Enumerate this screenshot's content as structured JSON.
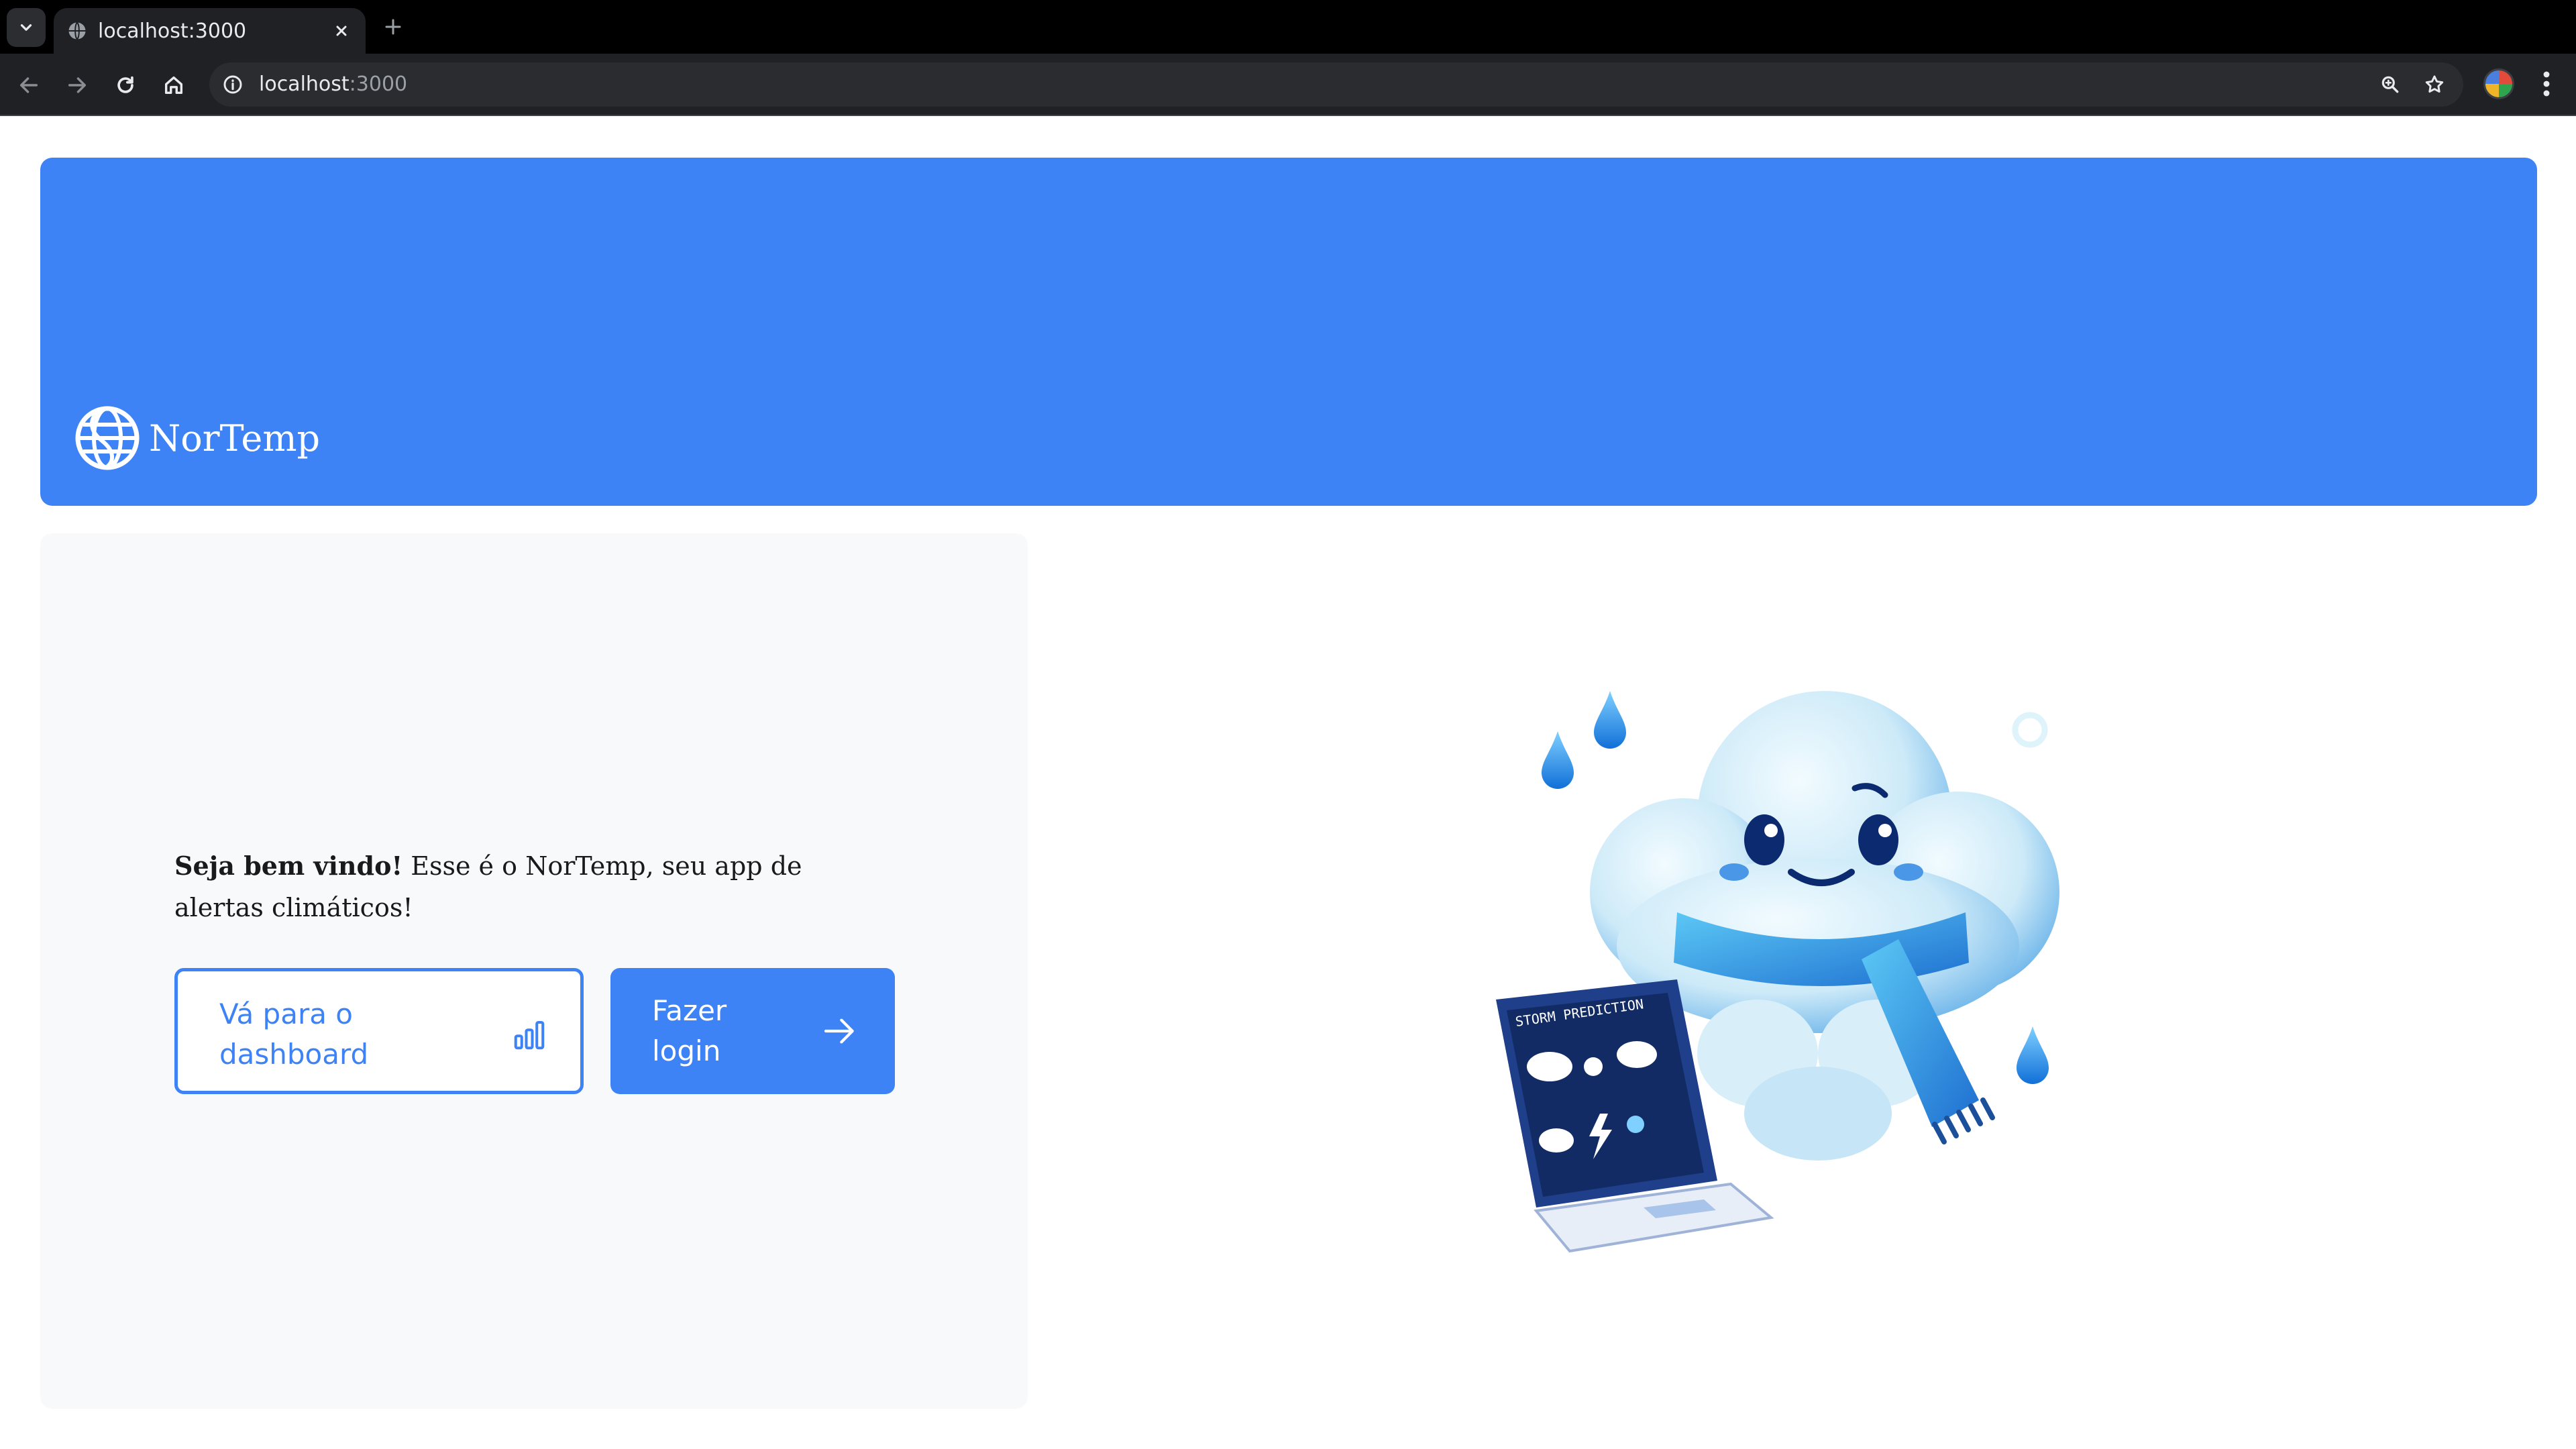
{
  "browser": {
    "tab": {
      "title": "localhost:3000"
    },
    "address": {
      "host": "localhost",
      "port": ":3000"
    }
  },
  "hero": {
    "brand_name": "NorTemp",
    "color": "#3d83f6"
  },
  "welcome": {
    "bold": "Seja bem vindo!",
    "text": " Esse é o NorTemp, seu app de alertas climáticos!"
  },
  "actions": {
    "dashboard_label": "Vá para o dashboard",
    "login_label": "Fazer login"
  },
  "illustration": {
    "screen_text": "STORM PREDICTION"
  },
  "icons": {
    "tab_list": "chevron-down-icon",
    "favicon": "globe-icon",
    "tab_close": "close-icon",
    "new_tab": "plus-icon",
    "back": "arrow-left-icon",
    "forward": "arrow-right-icon",
    "reload": "reload-icon",
    "home": "home-icon",
    "site_info": "info-icon",
    "zoom": "zoom-icon",
    "bookmark": "star-icon",
    "menu": "kebab-menu-icon",
    "brand": "globe-icon",
    "dashboard": "bar-chart-icon",
    "login": "arrow-right-icon"
  }
}
